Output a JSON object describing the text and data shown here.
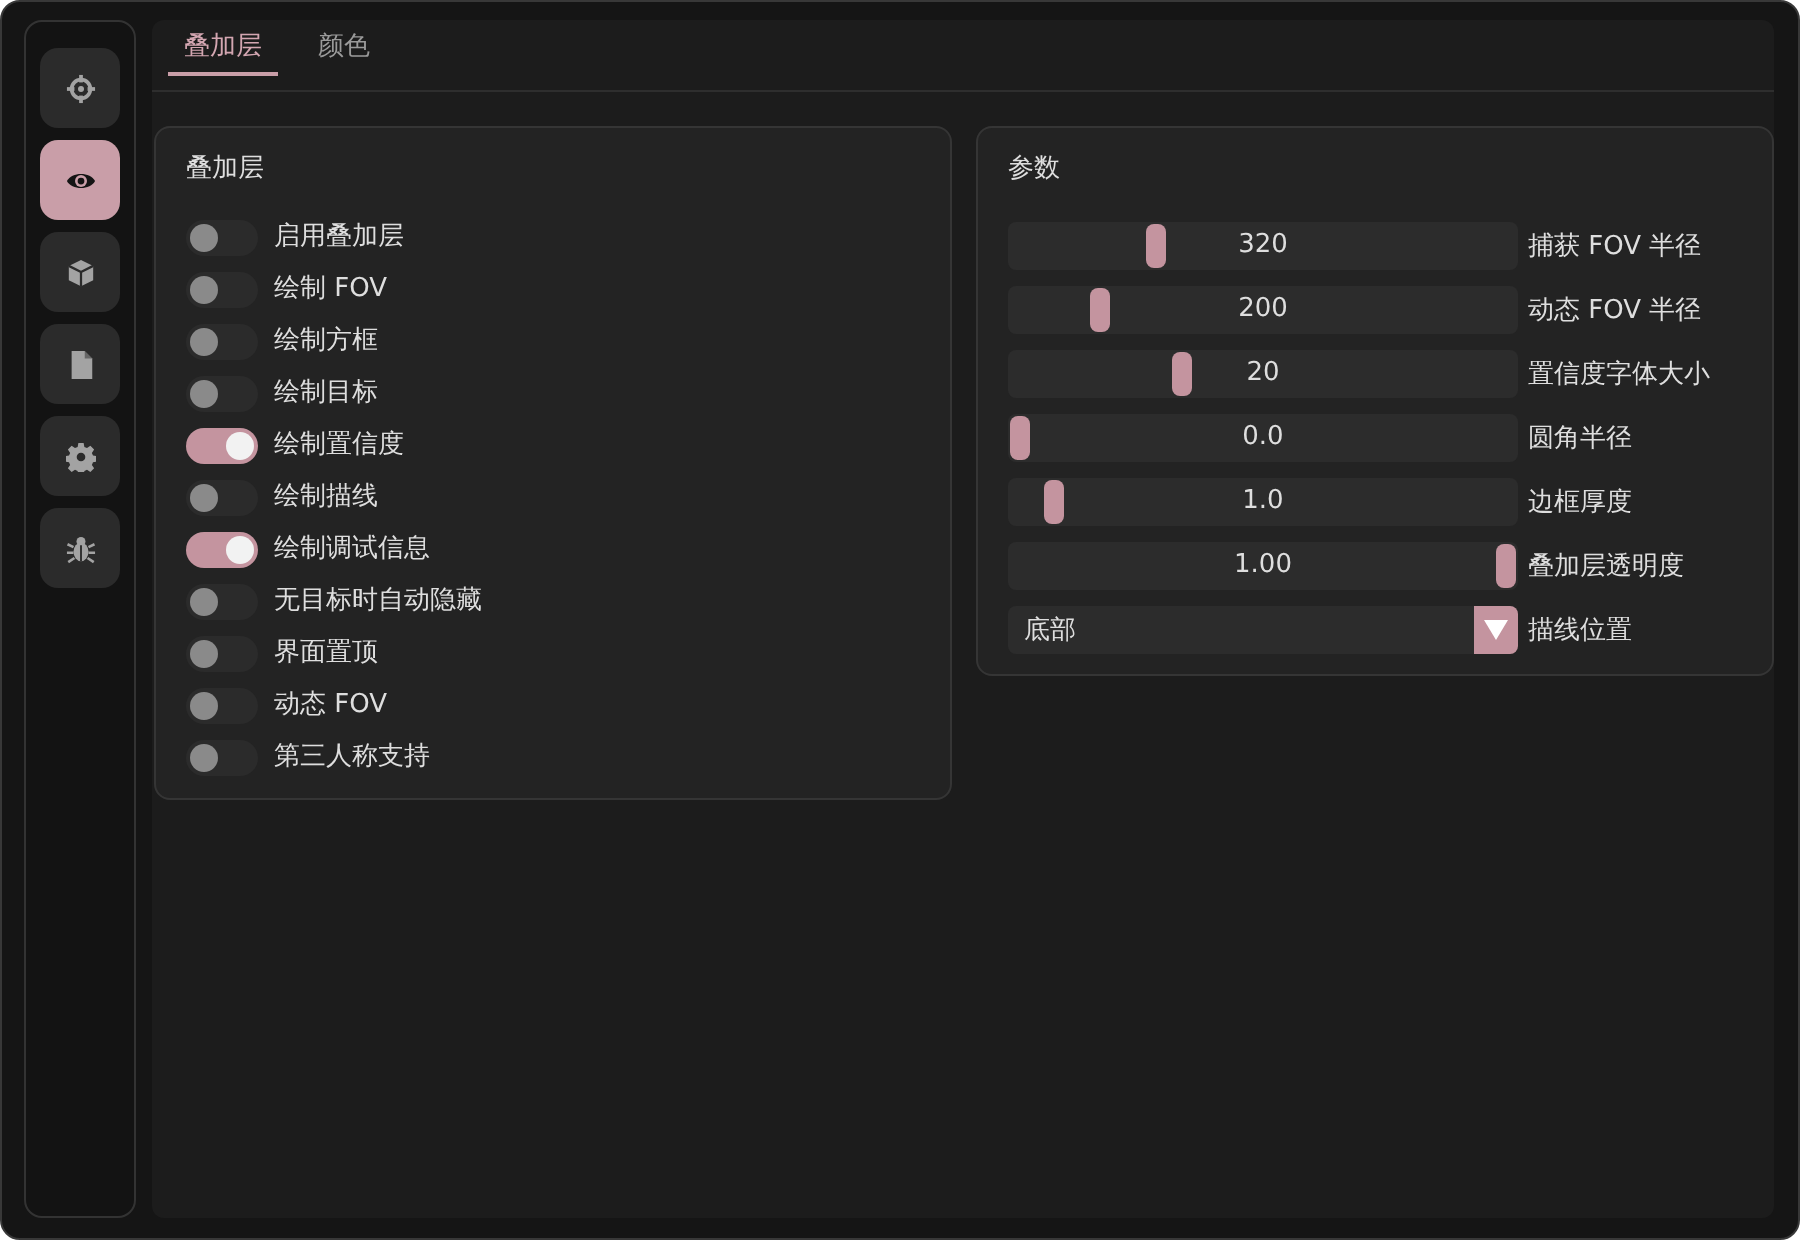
{
  "sidebar": {
    "items": [
      {
        "kind": "crosshair",
        "selected": false
      },
      {
        "kind": "eye",
        "selected": true
      },
      {
        "kind": "cube",
        "selected": false
      },
      {
        "kind": "document",
        "selected": false
      },
      {
        "kind": "gear",
        "selected": false
      },
      {
        "kind": "bug",
        "selected": false
      }
    ]
  },
  "tabs": [
    {
      "label": "叠加层",
      "selected": true
    },
    {
      "label": "颜色",
      "selected": false
    }
  ],
  "overlay_panel": {
    "title": "叠加层",
    "toggles": [
      {
        "label": "启用叠加层",
        "on": false
      },
      {
        "label": "绘制 FOV",
        "on": false
      },
      {
        "label": "绘制方框",
        "on": false
      },
      {
        "label": "绘制目标",
        "on": false
      },
      {
        "label": "绘制置信度",
        "on": true
      },
      {
        "label": "绘制描线",
        "on": false
      },
      {
        "label": "绘制调试信息",
        "on": true
      },
      {
        "label": "无目标时自动隐藏",
        "on": false
      },
      {
        "label": "界面置顶",
        "on": false
      },
      {
        "label": "动态 FOV",
        "on": false
      },
      {
        "label": "第三人称支持",
        "on": false
      }
    ]
  },
  "params_panel": {
    "title": "参数",
    "controls": [
      {
        "kind": "slider",
        "label": "捕获 FOV 半径",
        "value": "320",
        "level": 0.28
      },
      {
        "kind": "slider",
        "label": "动态 FOV 半径",
        "value": "200",
        "level": 0.165
      },
      {
        "kind": "slider",
        "label": "置信度字体大小",
        "value": "20",
        "level": 0.335
      },
      {
        "kind": "slider",
        "label": "圆角半径",
        "value": "0.0",
        "level": 0
      },
      {
        "kind": "slider",
        "label": "边框厚度",
        "value": "1.0",
        "level": 0.07
      },
      {
        "kind": "slider",
        "label": "叠加层透明度",
        "value": "1.00",
        "level": 1
      },
      {
        "kind": "dropdown",
        "label": "描线位置",
        "value": "底部"
      }
    ]
  }
}
